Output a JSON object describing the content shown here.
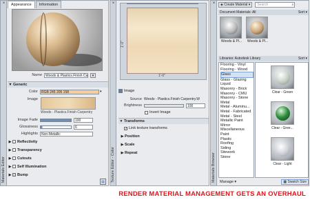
{
  "material_editor": {
    "tabs": [
      "Appearance",
      "Information"
    ],
    "name_label": "Name",
    "name_value": "Woods & Plastics.Finish Carpentry",
    "sections": {
      "generic": "Generic",
      "reflectivity": "Reflectivity",
      "transparency": "Transparency",
      "cutouts": "Cutouts",
      "self_illumination": "Self Illumination",
      "bump": "Bump"
    },
    "color_label": "Color",
    "color_value": "RGB 245 205 158",
    "image_label": "Image",
    "image_caption": "Woods - Plastics.Finish Carpentry",
    "image_fade_label": "Image Fade",
    "image_fade_value": "100",
    "glossiness_label": "Glossiness",
    "glossiness_value": "6",
    "highlights_label": "Highlights",
    "highlights_value": "Non-Metallic",
    "side_title": "Materials Editor"
  },
  "texture_editor": {
    "side_title": "Texture Editor - Color",
    "dim_top": "1'-0\"",
    "dim_side": "1'-0\"",
    "image_header": "Image",
    "source_label": "Source",
    "source_value": "Woods - Plastics.Finish Carpentry.W",
    "brightness_label": "Brightness",
    "brightness_value": "100",
    "invert_label": "Invert Image",
    "transforms_header": "Transforms",
    "link_label": "Link texture transforms",
    "position_label": "Position",
    "scale_label": "Scale",
    "repeat_label": "Repeat"
  },
  "browser": {
    "side_title": "Materials Browser",
    "create_label": "Create Material",
    "search_placeholder": "Search",
    "doc_materials_label": "Document Materials: All",
    "sort_label": "Sort",
    "doc_items": [
      "Woods & Pl...",
      "Woods & Pl..."
    ],
    "library_label": "Libraries: Autodesk Library",
    "categories": [
      "Flooring - Vinyl",
      "Flooring - Wood",
      "Glass",
      "Glass - Glazing",
      "Liquid",
      "Masonry - Brick",
      "Masonry - CMU",
      "Masonry - Stone",
      "Metal",
      "Metal - Aluminu...",
      "Metal - Fabricated",
      "Metal - Steel",
      "Metallic Paint",
      "Mirror",
      "Miscellaneous",
      "Paint",
      "Plastic",
      "Roofing",
      "Siding",
      "Sitework",
      "Stone"
    ],
    "selected_category": "Glass",
    "swatches": [
      "Clear - Green",
      "Clear - Gree...",
      "Clear - Light"
    ],
    "manage_label": "Manage",
    "swatch_size_label": "Swatch Size"
  },
  "caption": "RENDER MATERIAL MANAGEMENT GETS AN OVERHAUL"
}
